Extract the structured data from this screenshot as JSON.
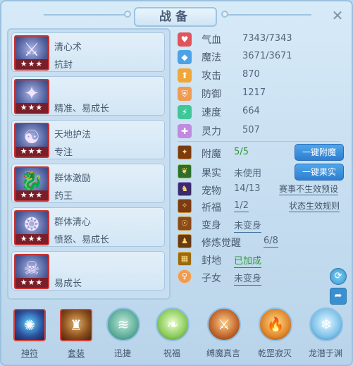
{
  "title": "战备",
  "cards": [
    {
      "name": "清心术",
      "attr": "抗封",
      "stars": "★★★",
      "icon": "swords-icon"
    },
    {
      "name": "",
      "attr": "精准、易成长",
      "stars": "★★★",
      "icon": "scepter-icon"
    },
    {
      "name": "天地护法",
      "attr": "专注",
      "stars": "★★★",
      "icon": "guardian-icon"
    },
    {
      "name": "群体激励",
      "attr": "药王",
      "stars": "★★★",
      "icon": "dragon-icon"
    },
    {
      "name": "群体清心",
      "attr": "愤怒、易成长",
      "stars": "★★★",
      "icon": "wheel-icon"
    },
    {
      "name": "",
      "attr": "易成长",
      "stars": "★★★",
      "icon": "mask-icon"
    }
  ],
  "stats": [
    {
      "label": "气血",
      "value": "7343/7343",
      "color": "#e0545c",
      "icon": "heart-icon"
    },
    {
      "label": "魔法",
      "value": "3671/3671",
      "color": "#4aa3e8",
      "icon": "diamond-icon"
    },
    {
      "label": "攻击",
      "value": "870",
      "color": "#f0a73a",
      "icon": "person-icon"
    },
    {
      "label": "防御",
      "value": "1217",
      "color": "#f09b52",
      "icon": "shield-icon"
    },
    {
      "label": "速度",
      "value": "664",
      "color": "#3fc79a",
      "icon": "lightning-icon"
    },
    {
      "label": "灵力",
      "value": "507",
      "color": "#c08ae0",
      "icon": "sparkle-icon"
    }
  ],
  "extras": {
    "fumo": {
      "label": "附魔",
      "value": "5/5"
    },
    "guoshi": {
      "label": "果实",
      "value": "未使用"
    },
    "chongwu": {
      "label": "宠物",
      "value": "14/13"
    },
    "qidao": {
      "label": "祈福",
      "value": "1/2"
    },
    "bianshen": {
      "label": "变身",
      "value": "未变身"
    },
    "xiulian": {
      "label": "修炼觉醒",
      "value": "6/8"
    },
    "fengdi": {
      "label": "封地",
      "value": "已加成"
    },
    "zinv": {
      "label": "子女",
      "value": "未变身"
    }
  },
  "buttons": {
    "one_click_enchant": "一键附魔",
    "one_click_fruit": "一键果实",
    "event_preset": "赛事不生效预设",
    "status_rules": "状态生效规则"
  },
  "tabs": [
    {
      "label": "神符",
      "icon": "orb-icon"
    },
    {
      "label": "套装",
      "icon": "chest-icon"
    },
    {
      "label": "迅捷",
      "icon": "wind-icon"
    },
    {
      "label": "祝福",
      "icon": "leaf-icon"
    },
    {
      "label": "缚魔真言",
      "icon": "warrior-icon"
    },
    {
      "label": "乾罡寂灭",
      "icon": "flame-icon"
    },
    {
      "label": "龙潜于渊",
      "icon": "dragon-head-icon"
    }
  ],
  "colors": {
    "accent": "#2f7ed0",
    "green": "#2e9a33",
    "border_red": "#c63434"
  }
}
